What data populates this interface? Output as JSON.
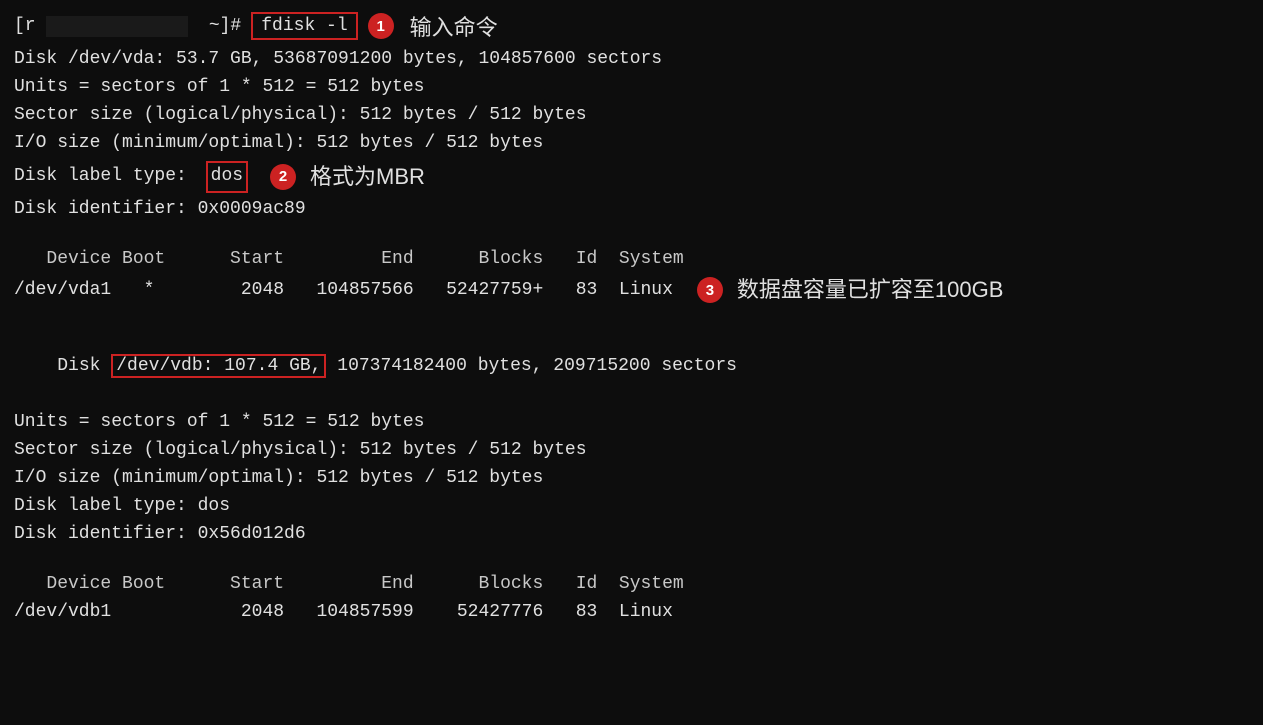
{
  "header": {
    "prompt_bracket_open": "[r",
    "prompt_user_host": "                ",
    "prompt_close": "~]#",
    "command": "fdisk -l",
    "badge1": "1",
    "annotation1": "输入命令"
  },
  "disk_vda": {
    "line1": "Disk /dev/vda: 53.7 GB, 53687091200 bytes, 104857600 sectors",
    "line2": "Units = sectors of 1 * 512 = 512 bytes",
    "line3": "Sector size (logical/physical): 512 bytes / 512 bytes",
    "line4": "I/O size (minimum/optimal): 512 bytes / 512 bytes",
    "line5_pre": "Disk label type: ",
    "line5_highlight": "dos",
    "badge2": "2",
    "annotation2": "格式为MBR",
    "line6": "Disk identifier: 0x0009ac89"
  },
  "table_vda": {
    "header": "   Device Boot      Start         End      Blocks   Id  System",
    "row1_pre": "/dev/vda1   *        2048   ",
    "row1_end": "104857566   52427759+   83  Linux"
  },
  "disk_vdb_annotation": {
    "badge3": "3",
    "annotation3": "数据盘容量已扩容至100GB"
  },
  "disk_vdb": {
    "line1_pre": "Disk ",
    "line1_highlight": "/dev/vdb: 107.4 GB,",
    "line1_rest": " 107374182400 bytes, 209715200 sectors",
    "line2": "Units = sectors of 1 * 512 = 512 bytes",
    "line3": "Sector size (logical/physical): 512 bytes / 512 bytes",
    "line4": "I/O size (minimum/optimal): 512 bytes / 512 bytes",
    "line5": "Disk label type: dos",
    "line6": "Disk identifier: 0x56d012d6"
  },
  "table_vdb": {
    "header": "   Device Boot      Start         End      Blocks   Id  System",
    "row1": "/dev/vdb1            2048   104857599    52427776   83  Linux"
  }
}
